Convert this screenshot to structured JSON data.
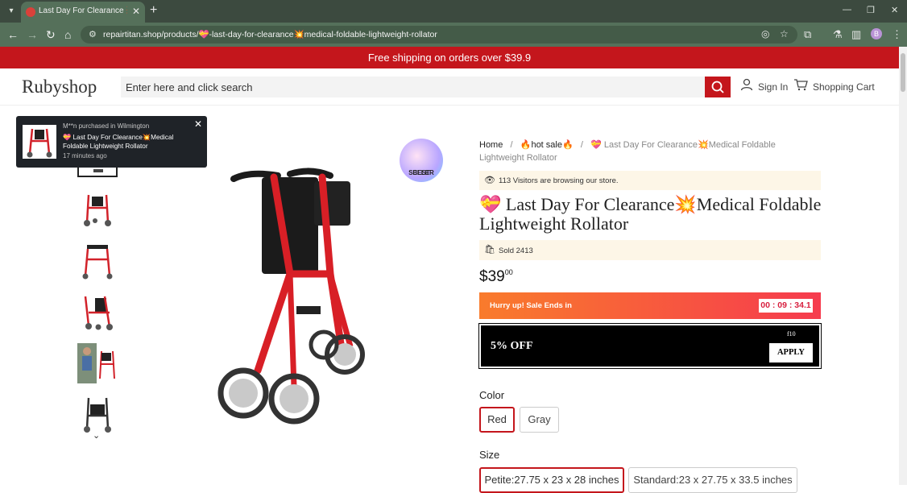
{
  "browser": {
    "tab_title": "Last Day For Clearance 💥 M",
    "url": "repairtitan.shop/products/💝-last-day-for-clearance💥medical-foldable-lightweight-rollator",
    "profile_initial": "B"
  },
  "promo_banner": "Free shipping on orders over $39.9",
  "header": {
    "logo": "Rubyshop",
    "search_placeholder": "Enter here and click search",
    "sign_in": "Sign In",
    "cart": "Shopping Cart"
  },
  "notification": {
    "line1": "M**n purchased in Wilmington",
    "line2": "💝 Last Day For Clearance💥Medical Foldable Lightweight Rollator",
    "line3": "17 minutes ago"
  },
  "badge": {
    "line1": "BEST",
    "line2": "SELLER"
  },
  "breadcrumb": {
    "home": "Home",
    "sep": "/",
    "hot": "🔥hot sale🔥",
    "current": "💝 Last Day For Clearance💥Medical Foldable Lightweight Rollator"
  },
  "visitors": "113 Visitors are browsing our store.",
  "product": {
    "title": "💝 Last Day For Clearance💥Medical Foldable Lightweight Rollator",
    "sold": "Sold 2413",
    "price_main": "$39",
    "price_cents": "00"
  },
  "sale": {
    "text": "Hurry up! Sale Ends in",
    "timer": "00 : 09 : 34.1"
  },
  "coupon": {
    "off": "5% OFF",
    "code": "f10",
    "apply": "APPLY"
  },
  "color": {
    "label": "Color",
    "options": [
      "Red",
      "Gray"
    ],
    "selected": "Red"
  },
  "size": {
    "label": "Size",
    "options": [
      "Petite:27.75 x 23 x 28 inches",
      "Standard:23 x 27.75 x 33.5 inches"
    ],
    "selected": "Petite:27.75 x 23 x 28 inches"
  },
  "colors": {
    "brand_red": "#c4161c",
    "browser_green": "#55705a"
  }
}
